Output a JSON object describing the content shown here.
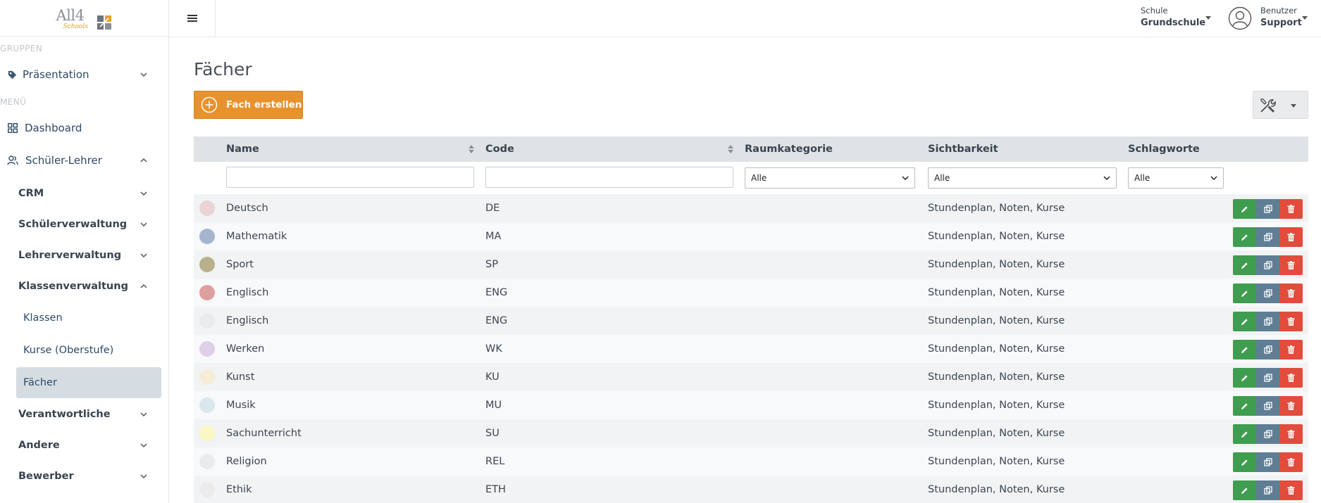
{
  "brand": {
    "name": "All4",
    "tagline": "Schools"
  },
  "sidebar": {
    "group_header": "GRUPPEN",
    "group_item": "Präsentation",
    "menu_header": "MENÜ",
    "items": {
      "dashboard": "Dashboard",
      "schueler_lehrer": "Schüler-Lehrer",
      "crm": "CRM",
      "schuelerverwaltung": "Schülerverwaltung",
      "lehrerverwaltung": "Lehrerverwaltung",
      "klassenverwaltung": "Klassenverwaltung",
      "klassen": "Klassen",
      "kurse": "Kurse (Oberstufe)",
      "faecher": "Fächer",
      "verantwortliche": "Verantwortliche",
      "andere": "Andere",
      "bewerber": "Bewerber"
    }
  },
  "topbar": {
    "school_label": "Schule",
    "school_value": "Grundschule",
    "user_label": "Benutzer",
    "user_value": "Support"
  },
  "page": {
    "title": "Fächer",
    "create_label": "Fach erstellen"
  },
  "table": {
    "columns": {
      "name": "Name",
      "code": "Code",
      "raumkategorie": "Raumkategorie",
      "sichtbarkeit": "Sichtbarkeit",
      "schlagworte": "Schlagworte"
    },
    "filters": {
      "name_value": "",
      "code_value": "",
      "raumkategorie": "Alle",
      "sichtbarkeit": "Alle",
      "schlagworte": "Alle"
    },
    "rows": [
      {
        "name": "Deutsch",
        "code": "DE",
        "raumkategorie": "",
        "sichtbarkeit": "Stundenplan, Noten, Kurse",
        "color": "#ecd3d6"
      },
      {
        "name": "Mathematik",
        "code": "MA",
        "raumkategorie": "",
        "sichtbarkeit": "Stundenplan, Noten, Kurse",
        "color": "#a6b5cf"
      },
      {
        "name": "Sport",
        "code": "SP",
        "raumkategorie": "",
        "sichtbarkeit": "Stundenplan, Noten, Kurse",
        "color": "#b8b08b"
      },
      {
        "name": "Englisch",
        "code": "ENG",
        "raumkategorie": "",
        "sichtbarkeit": "Stundenplan, Noten, Kurse",
        "color": "#de9f9f"
      },
      {
        "name": "Englisch",
        "code": "ENG",
        "raumkategorie": "",
        "sichtbarkeit": "Stundenplan, Noten, Kurse",
        "color": "#ebebeb"
      },
      {
        "name": "Werken",
        "code": "WK",
        "raumkategorie": "",
        "sichtbarkeit": "Stundenplan, Noten, Kurse",
        "color": "#e0cfe8"
      },
      {
        "name": "Kunst",
        "code": "KU",
        "raumkategorie": "",
        "sichtbarkeit": "Stundenplan, Noten, Kurse",
        "color": "#f6ecd8"
      },
      {
        "name": "Musik",
        "code": "MU",
        "raumkategorie": "",
        "sichtbarkeit": "Stundenplan, Noten, Kurse",
        "color": "#d9e8ec"
      },
      {
        "name": "Sachunterricht",
        "code": "SU",
        "raumkategorie": "",
        "sichtbarkeit": "Stundenplan, Noten, Kurse",
        "color": "#fbf7c4"
      },
      {
        "name": "Religion",
        "code": "REL",
        "raumkategorie": "",
        "sichtbarkeit": "Stundenplan, Noten, Kurse",
        "color": "#ebebeb"
      },
      {
        "name": "Ethik",
        "code": "ETH",
        "raumkategorie": "",
        "sichtbarkeit": "Stundenplan, Noten, Kurse",
        "color": "#ebebeb"
      }
    ]
  },
  "icons": {
    "menu": "hamburger-icon",
    "tag": "tag-icon",
    "dashboard": "grid-icon",
    "users": "users-icon",
    "create": "plus-circle-icon",
    "tools": "tools-icon",
    "edit": "pencil-icon",
    "copy": "copy-icon",
    "delete": "trash-icon"
  }
}
